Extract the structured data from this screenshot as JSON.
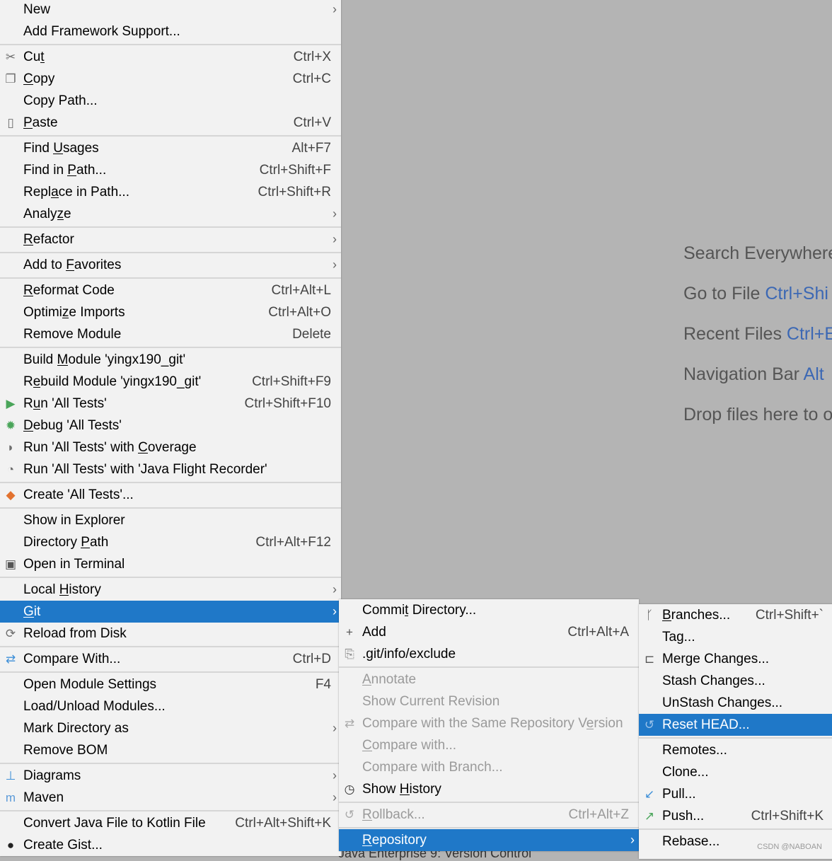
{
  "menus": {
    "main": [
      {
        "label": "New",
        "arrow": true
      },
      {
        "label": "Add Framework Support..."
      },
      {
        "sep": true
      },
      {
        "label": "Cut",
        "mn": 2,
        "shortcut": "Ctrl+X",
        "icon": "scissors-icon",
        "glyph": "✂"
      },
      {
        "label": "Copy",
        "mn": 0,
        "shortcut": "Ctrl+C",
        "icon": "copy-icon",
        "glyph": "❐"
      },
      {
        "label": "Copy Path..."
      },
      {
        "label": "Paste",
        "mn": 0,
        "shortcut": "Ctrl+V",
        "icon": "clipboard-icon",
        "glyph": "▯"
      },
      {
        "sep": true
      },
      {
        "label": "Find Usages",
        "mn": 5,
        "shortcut": "Alt+F7"
      },
      {
        "label": "Find in Path...",
        "mn": 8,
        "shortcut": "Ctrl+Shift+F"
      },
      {
        "label": "Replace in Path...",
        "mn": 4,
        "shortcut": "Ctrl+Shift+R"
      },
      {
        "label": "Analyze",
        "mn": 5,
        "arrow": true
      },
      {
        "sep": true
      },
      {
        "label": "Refactor",
        "mn": 0,
        "arrow": true
      },
      {
        "sep": true
      },
      {
        "label": "Add to Favorites",
        "mn": 7,
        "arrow": true
      },
      {
        "sep": true
      },
      {
        "label": "Reformat Code",
        "mn": 0,
        "shortcut": "Ctrl+Alt+L"
      },
      {
        "label": "Optimize Imports",
        "mn": 6,
        "shortcut": "Ctrl+Alt+O"
      },
      {
        "label": "Remove Module",
        "shortcut": "Delete"
      },
      {
        "sep": true
      },
      {
        "label": "Build Module 'yingx190_git'",
        "mn": 6
      },
      {
        "label": "Rebuild Module 'yingx190_git'",
        "mn": 1,
        "shortcut": "Ctrl+Shift+F9"
      },
      {
        "label": "Run 'All Tests'",
        "mn": 1,
        "shortcut": "Ctrl+Shift+F10",
        "icon": "run-icon",
        "glyph": "▶",
        "color": "#4aa55a"
      },
      {
        "label": "Debug 'All Tests'",
        "mn": 0,
        "icon": "debug-bug-icon",
        "glyph": "✹",
        "color": "#4aa55a"
      },
      {
        "label": "Run 'All Tests' with Coverage",
        "mn": 21,
        "icon": "coverage-icon",
        "glyph": "◗",
        "color": "#6e6e6e"
      },
      {
        "label": "Run 'All Tests' with 'Java Flight Recorder'",
        "icon": "profiler-icon",
        "glyph": "◔",
        "color": "#6e6e6e"
      },
      {
        "sep": true
      },
      {
        "label": "Create 'All Tests'...",
        "icon": "create-test-icon",
        "glyph": "◆",
        "color": "#e2722f"
      },
      {
        "sep": true
      },
      {
        "label": "Show in Explorer"
      },
      {
        "label": "Directory Path",
        "mn": 10,
        "shortcut": "Ctrl+Alt+F12"
      },
      {
        "label": "Open in Terminal",
        "icon": "terminal-icon",
        "glyph": "▣",
        "color": "#555"
      },
      {
        "sep": true
      },
      {
        "label": "Local History",
        "mn": 6,
        "arrow": true
      },
      {
        "label": "Git",
        "mn": 0,
        "arrow": true,
        "selected": true
      },
      {
        "label": "Reload from Disk",
        "icon": "reload-icon",
        "glyph": "⟳"
      },
      {
        "sep": true
      },
      {
        "label": "Compare With...",
        "shortcut": "Ctrl+D",
        "icon": "compare-icon",
        "glyph": "⇄",
        "color": "#3d8fd8"
      },
      {
        "sep": true
      },
      {
        "label": "Open Module Settings",
        "shortcut": "F4"
      },
      {
        "label": "Load/Unload Modules..."
      },
      {
        "label": "Mark Directory as",
        "arrow": true
      },
      {
        "label": "Remove BOM"
      },
      {
        "sep": true
      },
      {
        "label": "Diagrams",
        "arrow": true,
        "icon": "diagram-icon",
        "glyph": "⊥",
        "color": "#3d8fd8"
      },
      {
        "label": "Maven",
        "arrow": true,
        "icon": "maven-icon",
        "glyph": "m",
        "color": "#5b9ad8"
      },
      {
        "sep": true
      },
      {
        "label": "Convert Java File to Kotlin File",
        "shortcut": "Ctrl+Alt+Shift+K"
      },
      {
        "label": "Create Gist...",
        "icon": "github-icon",
        "glyph": "●",
        "color": "#222"
      }
    ],
    "git": [
      {
        "label": "Commit Directory...",
        "mn": 5
      },
      {
        "label": "Add",
        "shortcut": "Ctrl+Alt+A",
        "icon": "plus-icon",
        "glyph": "+",
        "color": "#555"
      },
      {
        "label": ".git/info/exclude",
        "icon": "ignore-file-icon",
        "glyph": "⎘",
        "color": "#888"
      },
      {
        "sep": true
      },
      {
        "label": "Annotate",
        "mn": 0,
        "disabled": true
      },
      {
        "label": "Show Current Revision",
        "disabled": true
      },
      {
        "label": "Compare with the Same Repository Version",
        "mn": 34,
        "disabled": true,
        "icon": "compare-icon",
        "glyph": "⇄",
        "color": "#aaa"
      },
      {
        "label": "Compare with...",
        "mn": 0,
        "disabled": true
      },
      {
        "label": "Compare with Branch...",
        "disabled": true
      },
      {
        "label": "Show History",
        "mn": 5,
        "icon": "history-clock-icon",
        "glyph": "◷",
        "color": "#333"
      },
      {
        "sep": true
      },
      {
        "label": "Rollback...",
        "mn": 0,
        "shortcut": "Ctrl+Alt+Z",
        "disabled": true,
        "icon": "rollback-icon",
        "glyph": "↺",
        "color": "#aaa"
      },
      {
        "sep": true
      },
      {
        "label": "Repository",
        "mn": 0,
        "arrow": true,
        "selected": true
      }
    ],
    "repo": [
      {
        "label": "Branches...",
        "mn": 0,
        "shortcut": "Ctrl+Shift+`",
        "icon": "branch-icon",
        "glyph": "ᚴ",
        "color": "#555"
      },
      {
        "label": "Tag..."
      },
      {
        "label": "Merge Changes...",
        "icon": "merge-icon",
        "glyph": "⊏",
        "color": "#555"
      },
      {
        "label": "Stash Changes..."
      },
      {
        "label": "UnStash Changes..."
      },
      {
        "label": "Reset HEAD...",
        "selected": true,
        "icon": "reset-icon",
        "glyph": "↺",
        "color": "#9cc3ea"
      },
      {
        "sep": true
      },
      {
        "label": "Remotes..."
      },
      {
        "label": "Clone..."
      },
      {
        "label": "Pull...",
        "icon": "pull-arrow-icon",
        "glyph": "↙",
        "color": "#3d8fd8"
      },
      {
        "label": "Push...",
        "shortcut": "Ctrl+Shift+K",
        "icon": "push-arrow-icon",
        "glyph": "↗",
        "color": "#4aa55a"
      },
      {
        "sep": true
      },
      {
        "label": "Rebase..."
      }
    ]
  },
  "empty_state": [
    {
      "text": "Search Everywhere ",
      "key": ""
    },
    {
      "text": "Go to File ",
      "key": "Ctrl+Shi"
    },
    {
      "text": "Recent Files ",
      "key": "Ctrl+E"
    },
    {
      "text": "Navigation Bar ",
      "key": "Alt"
    },
    {
      "text": "Drop files here to o",
      "key": ""
    }
  ],
  "underlying_tabs": "Java Enterprise      9: Version Control",
  "watermark": "CSDN @NABOAN"
}
